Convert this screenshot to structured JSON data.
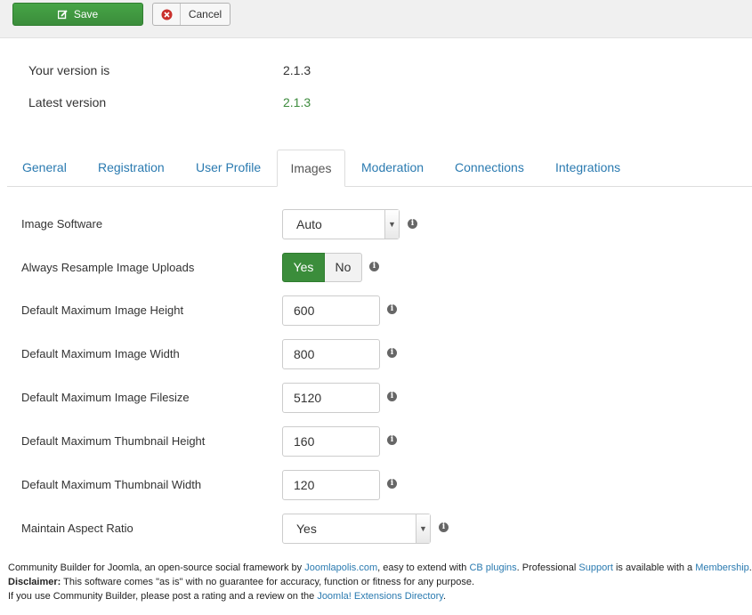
{
  "toolbar": {
    "save_label": "Save",
    "cancel_label": "Cancel"
  },
  "version": {
    "yours_label": "Your version is",
    "yours_value": "2.1.3",
    "latest_label": "Latest version",
    "latest_value": "2.1.3",
    "latest_color": "#3d8b3d"
  },
  "tabs": [
    {
      "label": "General"
    },
    {
      "label": "Registration"
    },
    {
      "label": "User Profile"
    },
    {
      "label": "Images"
    },
    {
      "label": "Moderation"
    },
    {
      "label": "Connections"
    },
    {
      "label": "Integrations"
    }
  ],
  "active_tab": "Images",
  "fields": {
    "image_software": {
      "label": "Image Software",
      "value": "Auto"
    },
    "resample": {
      "label": "Always Resample Image Uploads",
      "yes": "Yes",
      "no": "No",
      "selected": "Yes"
    },
    "max_height": {
      "label": "Default Maximum Image Height",
      "value": "600"
    },
    "max_width": {
      "label": "Default Maximum Image Width",
      "value": "800"
    },
    "max_filesize": {
      "label": "Default Maximum Image Filesize",
      "value": "5120"
    },
    "thumb_height": {
      "label": "Default Maximum Thumbnail Height",
      "value": "160"
    },
    "thumb_width": {
      "label": "Default Maximum Thumbnail Width",
      "value": "120"
    },
    "aspect": {
      "label": "Maintain Aspect Ratio",
      "value": "Yes"
    }
  },
  "footer": {
    "l1_a": "Community Builder for Joomla, an open-source social framework by ",
    "l1_link1": "Joomlapolis.com",
    "l1_b": ", easy to extend with ",
    "l1_link2": "CB plugins",
    "l1_c": ". Professional ",
    "l1_link3": "Support",
    "l1_d": " is available with a ",
    "l1_link4": "Membership",
    "l1_e": ".",
    "l2_bold": "Disclaimer:",
    "l2_text": " This software comes \"as is\" with no guarantee for accuracy, function or fitness for any purpose.",
    "l3_text": "If you use Community Builder, please post a rating and a review on the ",
    "l3_link": "Joomla! Extensions Directory",
    "l3_end": "."
  },
  "colors": {
    "accent_green": "#3b8d3b",
    "link_blue": "#2a7ab0"
  },
  "icons": {
    "save": "edit-icon",
    "cancel": "close-circle-icon",
    "info": "info-icon"
  }
}
